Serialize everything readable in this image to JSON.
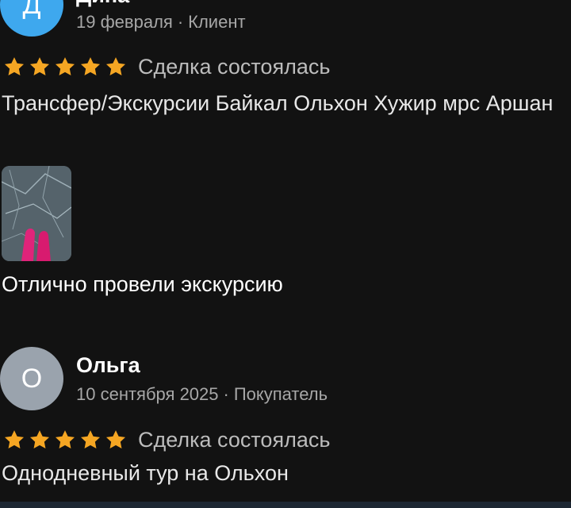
{
  "colors": {
    "background": "#121212",
    "star": "#f5a623",
    "avatar_1": "#3ea8ee",
    "avatar_2": "#9aa3ad"
  },
  "reviews": [
    {
      "avatar_letter": "Д",
      "name": "Дина",
      "date": "19 февраля",
      "separator": "·",
      "role": "Клиент",
      "stars": 5,
      "status": "Сделка состоялась",
      "title": "Трансфер/Экскурсии Байкал Ольхон Хужир мрс Аршан",
      "comment": "Отлично провели экскурсию"
    },
    {
      "avatar_letter": "О",
      "name": "Ольга",
      "date": "10 сентября 2025",
      "separator": "·",
      "role": "Покупатель",
      "stars": 5,
      "status": "Сделка состоялась",
      "title": "Однодневный тур на Ольхон"
    }
  ]
}
